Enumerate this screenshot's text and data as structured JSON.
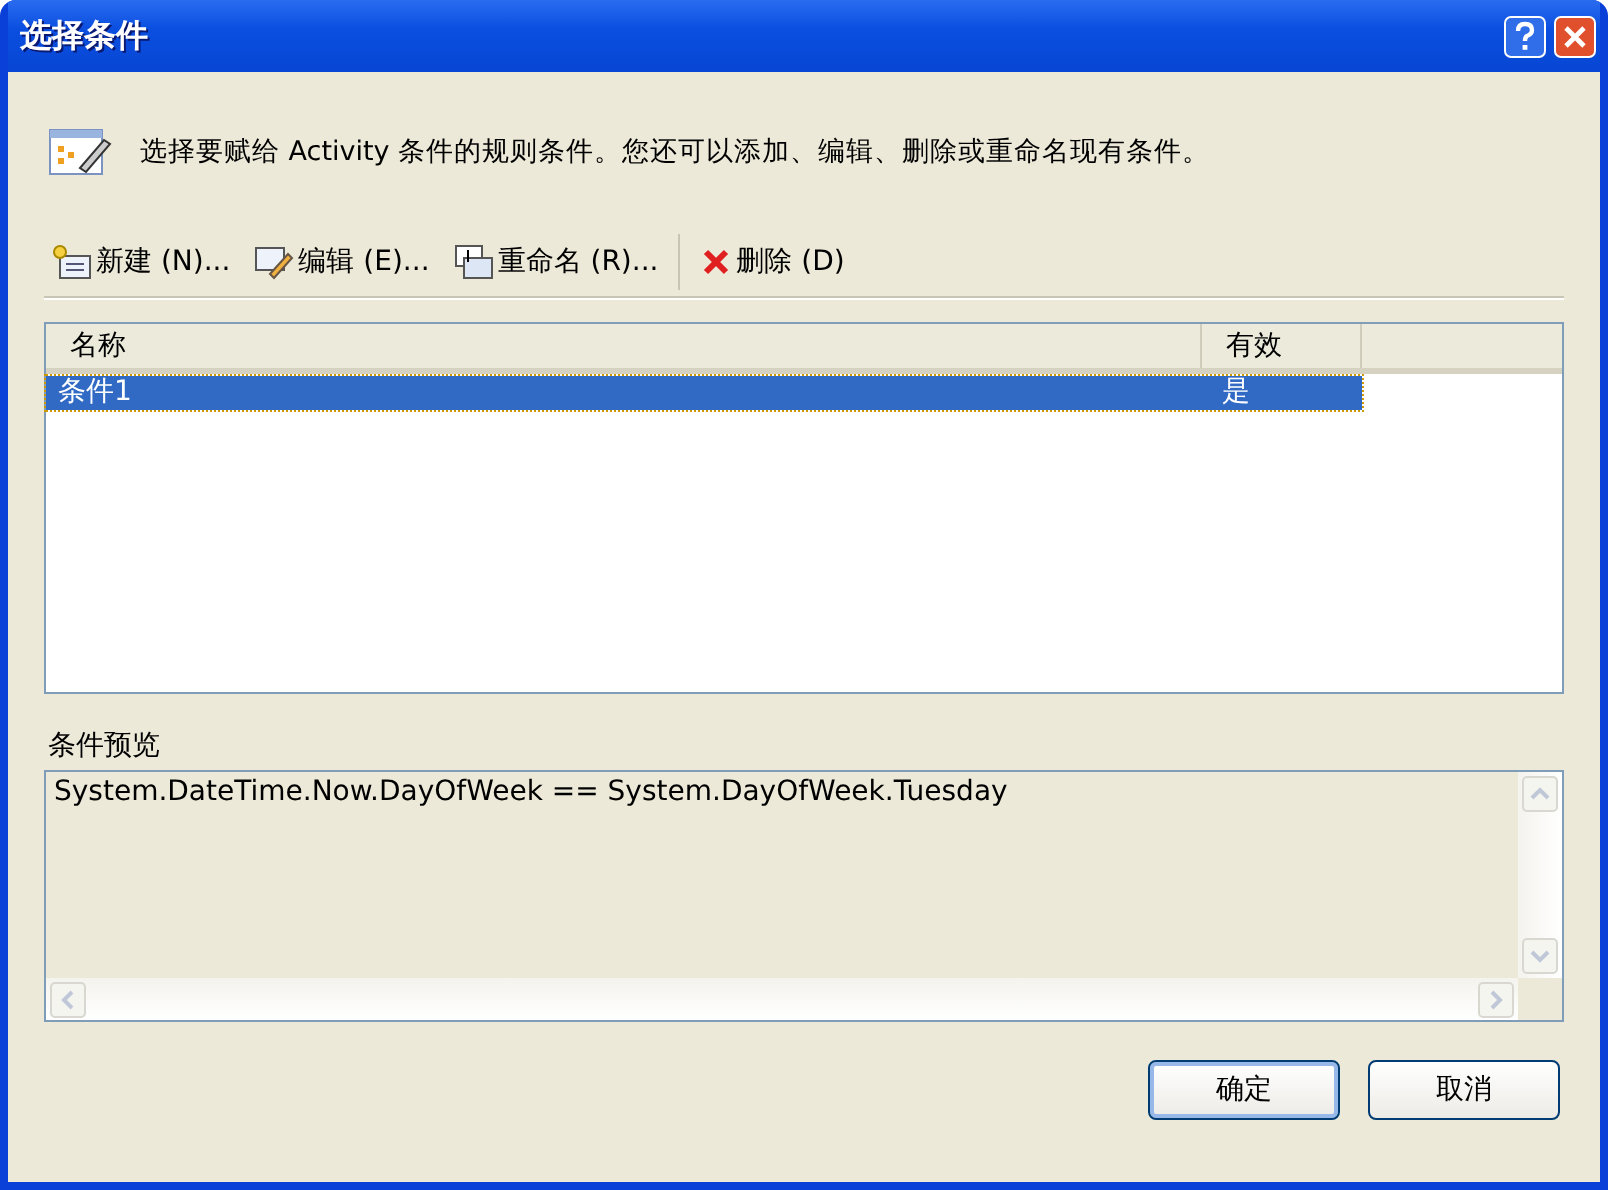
{
  "window": {
    "title": "选择条件"
  },
  "intro": "选择要赋给 Activity 条件的规则条件。您还可以添加、编辑、删除或重命名现有条件。",
  "toolbar": [
    {
      "kind": "new",
      "label": "新建 (N)..."
    },
    {
      "kind": "edit",
      "label": "编辑 (E)..."
    },
    {
      "kind": "rename",
      "label": "重命名 (R)..."
    },
    {
      "kind": "delete",
      "label": "删除 (D)"
    }
  ],
  "table": {
    "columns": [
      "名称",
      "有效"
    ],
    "rows": [
      {
        "cells": [
          "条件1",
          "是"
        ],
        "selected": true
      }
    ]
  },
  "preview": {
    "label": "条件预览",
    "value": "System.DateTime.Now.DayOfWeek == System.DayOfWeek.Tuesday"
  },
  "buttons": [
    {
      "label": "确定",
      "default": true
    },
    {
      "label": "取消",
      "default": false
    }
  ]
}
